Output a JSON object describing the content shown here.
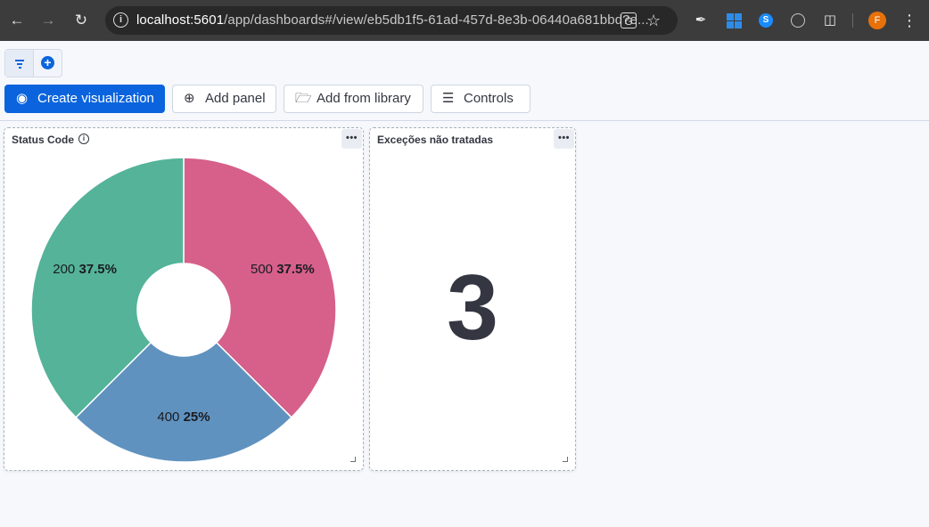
{
  "browser": {
    "url_host": "localhost:5601",
    "url_path": "/app/dashboards#/view/eb5db1f5-61ad-457d-8e3b-06440a681bbd?e...",
    "profile_initial": "F"
  },
  "toolbar": {
    "create_visualization": "Create visualization",
    "add_panel": "Add panel",
    "add_from_library": "Add from library",
    "controls": "Controls"
  },
  "panels": [
    {
      "title": "Status Code",
      "menu": "•••"
    },
    {
      "title": "Exceções não tratadas",
      "menu": "•••",
      "metric_value": "3"
    }
  ],
  "chart_data": {
    "type": "pie",
    "title": "Status Code",
    "slices": [
      {
        "label": "500",
        "percent": "37.5%",
        "value": 37.5,
        "color": "#d6608a"
      },
      {
        "label": "400",
        "percent": "25%",
        "value": 25,
        "color": "#6092c0"
      },
      {
        "label": "200",
        "percent": "37.5%",
        "value": 37.5,
        "color": "#54b399"
      }
    ],
    "donut": true
  }
}
